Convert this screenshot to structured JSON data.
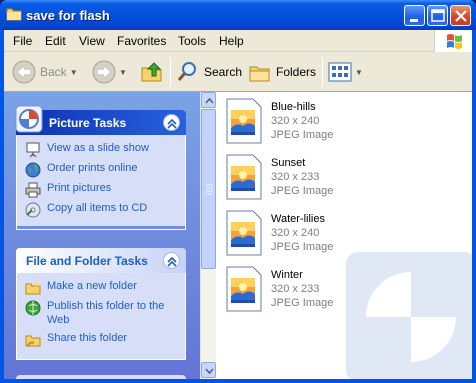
{
  "window": {
    "title": "save for flash",
    "controls": [
      "minimize",
      "maximize",
      "close"
    ]
  },
  "menu": [
    "File",
    "Edit",
    "View",
    "Favorites",
    "Tools",
    "Help"
  ],
  "toolbar": {
    "back_label": "Back",
    "search_label": "Search",
    "folders_label": "Folders"
  },
  "tasks": {
    "picture": {
      "title": "Picture Tasks",
      "items": [
        {
          "label": "View as a slide show",
          "icon": "slideshow-icon"
        },
        {
          "label": "Order prints online",
          "icon": "globe-icon"
        },
        {
          "label": "Print pictures",
          "icon": "printer-icon"
        },
        {
          "label": "Copy all items to CD",
          "icon": "cd-icon"
        }
      ]
    },
    "file_folder": {
      "title": "File and Folder Tasks",
      "items": [
        {
          "label": "Make a new folder",
          "icon": "new-folder-icon"
        },
        {
          "label": "Publish this folder to the Web",
          "icon": "publish-web-icon"
        },
        {
          "label": "Share this folder",
          "icon": "share-folder-icon"
        }
      ]
    }
  },
  "files": [
    {
      "name": "Blue-hills",
      "dimensions": "320 x 240",
      "type": "JPEG Image"
    },
    {
      "name": "Sunset",
      "dimensions": "320 x 233",
      "type": "JPEG Image"
    },
    {
      "name": "Water-lilies",
      "dimensions": "320 x 240",
      "type": "JPEG Image"
    },
    {
      "name": "Winter",
      "dimensions": "320 x 233",
      "type": "JPEG Image"
    }
  ],
  "colors": {
    "titlebar": "#0a5ce6",
    "task_link": "#215dc6",
    "task_pane": "#7ba2e7",
    "chrome": "#ece9d8"
  }
}
